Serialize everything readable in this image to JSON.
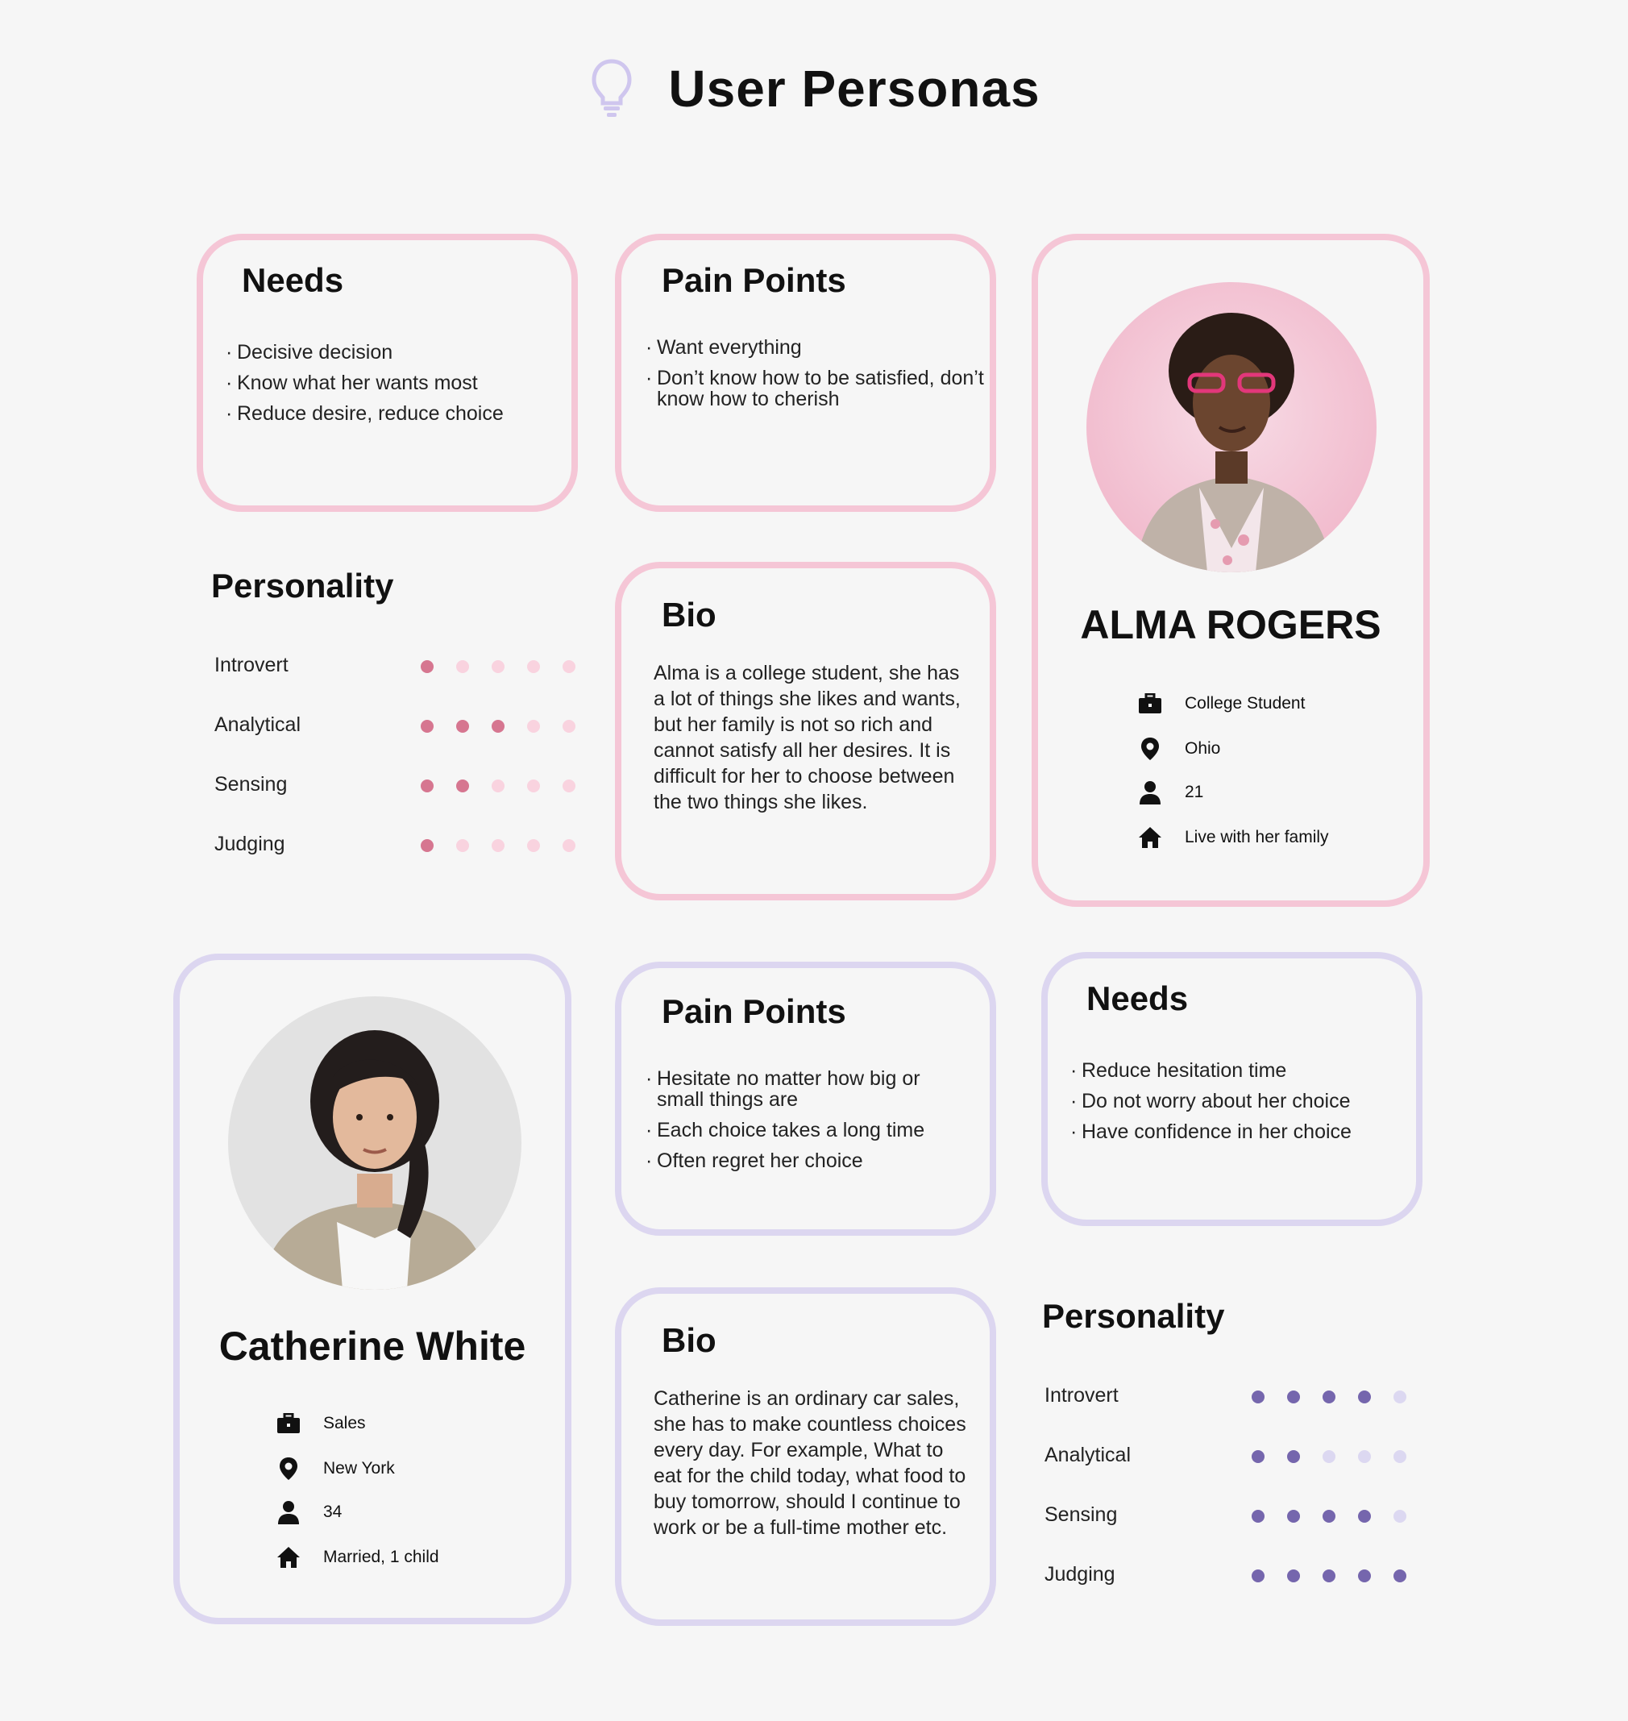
{
  "page": {
    "title": "User Personas",
    "title_icon": "lightbulb-icon"
  },
  "colors": {
    "pink_border": "#f5c6d6",
    "purple_border": "#dcd6f0",
    "pink_dot": "#d67690",
    "pink_dot_off": "#f9d3df",
    "purple_dot": "#7566ad",
    "purple_dot_off": "#dcd8f1"
  },
  "alma": {
    "needs": {
      "heading": "Needs",
      "items": [
        "Decisive decision",
        "Know what her wants most",
        "Reduce desire, reduce choice"
      ]
    },
    "pain_points": {
      "heading": "Pain Points",
      "items": [
        "Want everything",
        "Don’t know how to be satisfied, don’t know how to cherish"
      ]
    },
    "bio": {
      "heading": "Bio",
      "text": "Alma is a college student, she has a lot of things she likes and wants, but her family is not so rich and cannot satisfy all her desires. It is difficult for her to choose between the two things she likes."
    },
    "personality": {
      "heading": "Personality",
      "traits": [
        {
          "label": "Introvert",
          "level": 1,
          "max": 5
        },
        {
          "label": "Analytical",
          "level": 3,
          "max": 5
        },
        {
          "label": "Sensing",
          "level": 2,
          "max": 5
        },
        {
          "label": "Judging",
          "level": 1,
          "max": 5
        }
      ]
    },
    "profile": {
      "name": "ALMA ROGERS",
      "occupation": "College Student",
      "location": "Ohio",
      "age": "21",
      "living": "Live with her family"
    }
  },
  "catherine": {
    "profile": {
      "name": "Catherine White",
      "occupation": "Sales",
      "location": "New York",
      "age": "34",
      "living": "Married, 1 child"
    },
    "pain_points": {
      "heading": "Pain Points",
      "items": [
        "Hesitate no matter how big or small things are",
        "Each choice takes a long time",
        "Often regret her choice"
      ]
    },
    "needs": {
      "heading": "Needs",
      "items": [
        "Reduce hesitation time",
        "Do not worry about her choice",
        "Have confidence in her choice"
      ]
    },
    "bio": {
      "heading": "Bio",
      "text": "Catherine is an ordinary car sales, she has to make countless choices every day.  For example, What to eat for the child today, what food to buy tomorrow, should I continue to work or be a full-time mother etc."
    },
    "personality": {
      "heading": "Personality",
      "traits": [
        {
          "label": "Introvert",
          "level": 4,
          "max": 5
        },
        {
          "label": "Analytical",
          "level": 2,
          "max": 5
        },
        {
          "label": "Sensing",
          "level": 4,
          "max": 5
        },
        {
          "label": "Judging",
          "level": 5,
          "max": 5
        }
      ]
    }
  }
}
